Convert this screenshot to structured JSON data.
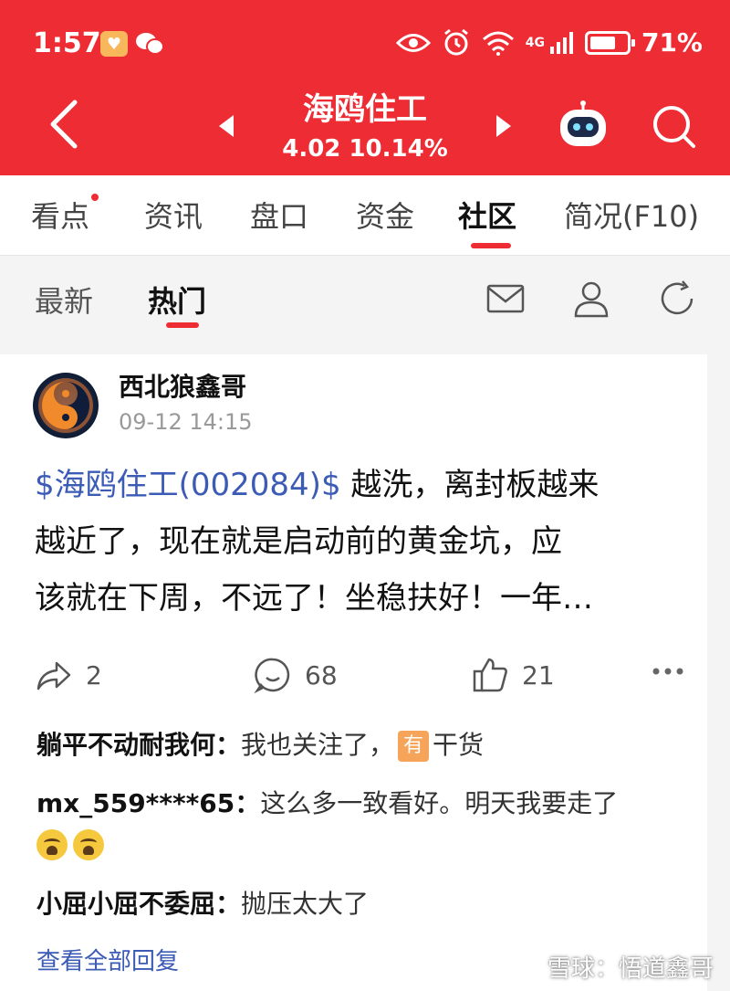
{
  "status_bar": {
    "time": "1:57",
    "network": "4G",
    "battery_percent": "71%",
    "battery_level": 0.71
  },
  "header": {
    "stock_name": "海鸥住工",
    "price_change": "4.02  10.14%"
  },
  "main_tabs": [
    {
      "label": "看点"
    },
    {
      "label": "资讯"
    },
    {
      "label": "盘口"
    },
    {
      "label": "资金"
    },
    {
      "label": "社区"
    },
    {
      "label": "简况(F10)"
    }
  ],
  "sub_tabs": [
    {
      "label": "最新"
    },
    {
      "label": "热门"
    }
  ],
  "post": {
    "author": "西北狼鑫哥",
    "time": "09-12 14:15",
    "stock_tag": "$海鸥住工(002084)$",
    "text_line1": " 越洗，离封板越来",
    "text_line2": "越近了，现在就是启动前的黄金坑，应",
    "text_line3": "该就在下周，不远了！坐稳扶好！一年…",
    "shares": "2",
    "comments": "68",
    "likes": "21"
  },
  "replies": [
    {
      "name": "躺平不动耐我何：",
      "text_before": "我也关注了，",
      "badge": "有",
      "text_after": "干货"
    },
    {
      "name": "mx_559****65：",
      "text": "这么多一致看好。明天我要走了"
    },
    {
      "name": "小屈小屈不委屈：",
      "text": "抛压太大了"
    }
  ],
  "view_all": "查看全部回复",
  "watermark": "雪球：悟道鑫哥",
  "colors": {
    "brand_red": "#ee2c34",
    "link_blue": "#3b5bb5"
  }
}
